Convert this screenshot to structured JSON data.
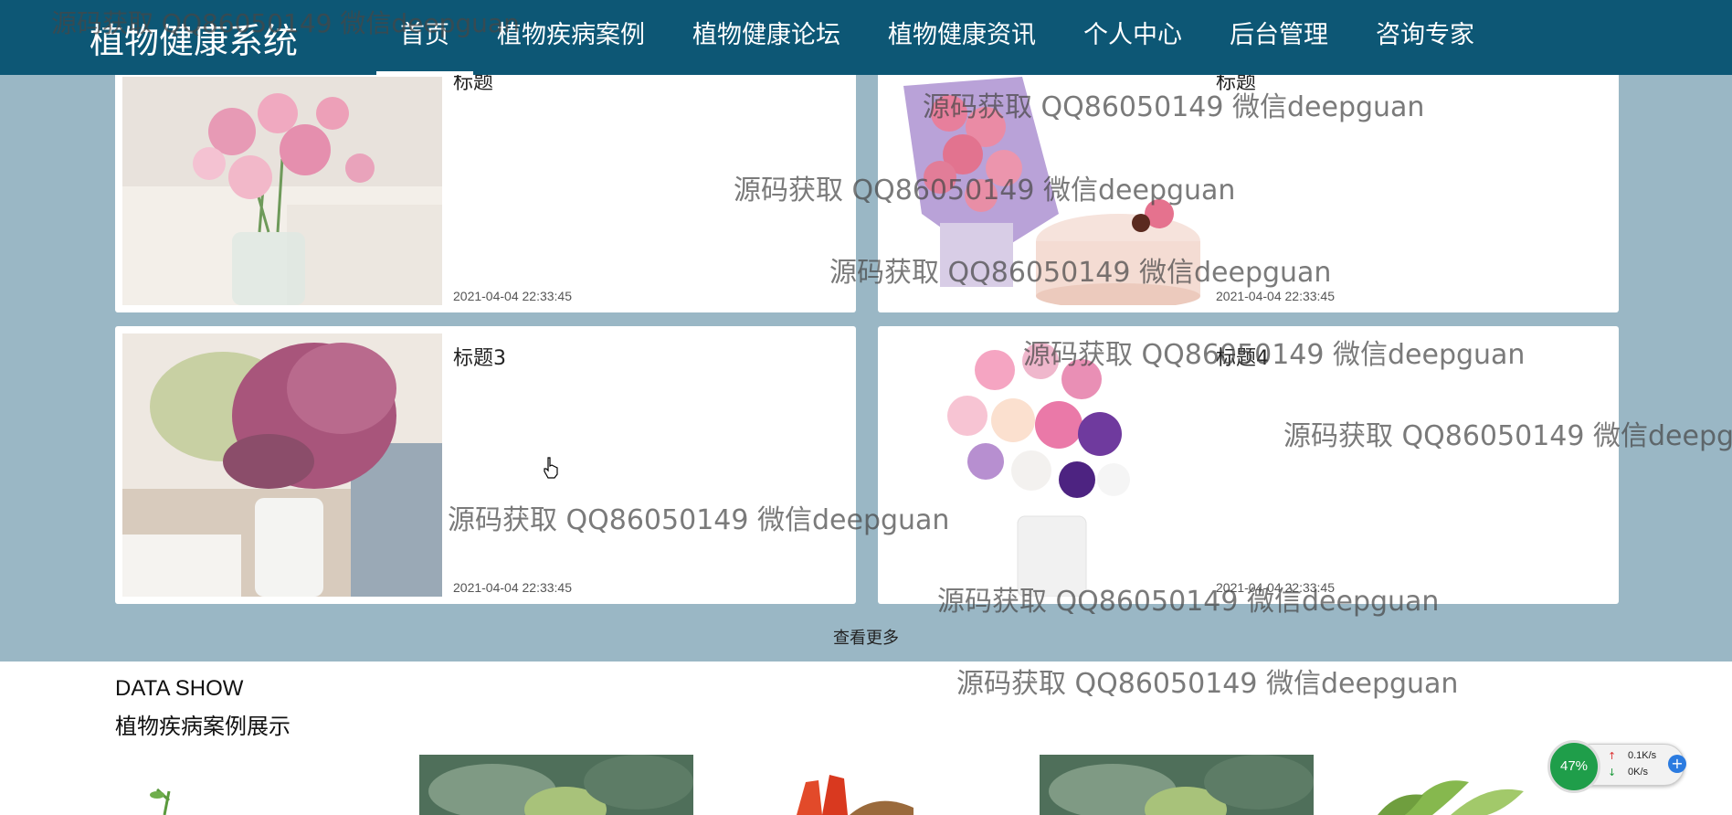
{
  "nav": {
    "brand": "植物健康系统",
    "items": [
      {
        "label": "首页",
        "active": true
      },
      {
        "label": "植物疾病案例"
      },
      {
        "label": "植物健康论坛"
      },
      {
        "label": "植物健康资讯"
      },
      {
        "label": "个人中心"
      },
      {
        "label": "后台管理"
      },
      {
        "label": "咨询专家"
      }
    ]
  },
  "news": {
    "cards": [
      {
        "title": "标题",
        "date": "2021-04-04 22:33:45",
        "image": "pink-ranunculus-in-jar"
      },
      {
        "title": "标题",
        "date": "2021-04-04 22:33:45",
        "image": "carnation-bouquet-and-cake"
      },
      {
        "title": "标题3",
        "date": "2021-04-04 22:33:45",
        "image": "dried-flowers-in-vase"
      },
      {
        "title": "标题4",
        "date": "2021-04-04 22:33:45",
        "image": "lisianthus-vase"
      }
    ],
    "more_label": "查看更多"
  },
  "cases_section": {
    "title_en": "DATA SHOW",
    "title_cn": "植物疾病案例展示",
    "items": [
      {
        "image": "green-plant"
      },
      {
        "image": "broccoli"
      },
      {
        "image": "carrots"
      },
      {
        "image": "broccoli"
      },
      {
        "image": "green-plant"
      }
    ]
  },
  "watermark": {
    "text": "源码获取 QQ86050149 微信deepguan"
  },
  "net_monitor": {
    "percent": "47%",
    "up": "0.1K/s",
    "down": "0K/s"
  },
  "colors": {
    "nav_bg": "#0d5775",
    "band_bg": "#9ab7c5",
    "monitor_green": "#1f9e4a"
  }
}
